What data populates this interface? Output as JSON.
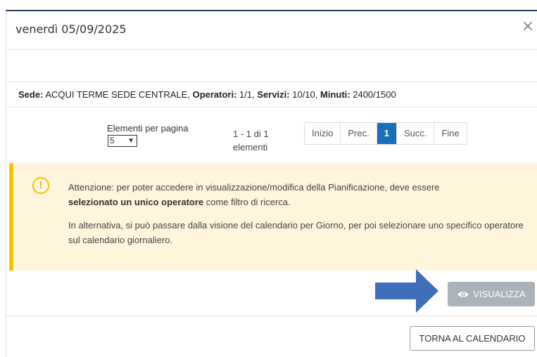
{
  "modal": {
    "title": "venerdì 05/09/2025",
    "close_glyph": "×"
  },
  "summary": {
    "sede_label": "Sede:",
    "sede_value": "ACQUI TERME SEDE CENTRALE,",
    "operatori_label": "Operatori:",
    "operatori_value": "1/1,",
    "servizi_label": "Servizi:",
    "servizi_value": "10/10,",
    "minuti_label": "Minuti:",
    "minuti_value": "2400/1500"
  },
  "pager": {
    "per_page_label": "Elementi per pagina",
    "per_page_value": "5",
    "range_text": "1 - 1 di 1",
    "range_suffix": "elementi",
    "buttons": [
      "Inizio",
      "Prec.",
      "1",
      "Succ.",
      "Fine"
    ],
    "active_page": "1"
  },
  "alert": {
    "icon": "warning-circle-icon",
    "p1_part1": "Attenzione: per poter accedere in visualizzazione/modifica della Pianificazione, deve essere",
    "p1_bold": "selezionato un unico operatore",
    "p1_part2": " come filtro di ricerca.",
    "p2": "In alternativa, si può passare dalla visione del calendario per Giorno, per poi selezionare uno specifico operatore sul calendario giornaliero.",
    "border_color": "#f5c400",
    "bg_color": "#fef5da"
  },
  "actions": {
    "visualizza_label": "VISUALIZZA",
    "torna_label": "TORNA AL CALENDARIO"
  },
  "colors": {
    "active_page": "#1b6fb8",
    "arrow": "#3f6fba",
    "visualizza_bg": "#aab3ba"
  }
}
